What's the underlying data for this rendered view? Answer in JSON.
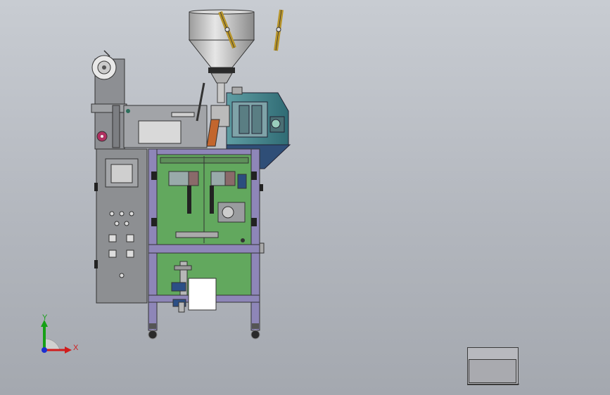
{
  "viewport": {
    "name": "cad-3d-model-viewport",
    "background_top": "#c8ccd2",
    "background_bottom": "#a4a8af"
  },
  "triad": {
    "x_label": "X",
    "y_label": "Y",
    "x_color": "#d11c1c",
    "y_color": "#16a016",
    "z_color": "#1c2fd1"
  },
  "model": {
    "frame_color": "#8e86b8",
    "panel_color": "#8e9093",
    "guard_color": "#62a85e",
    "machine_body_color": "#3f7f86",
    "hopper_color": "#c7c7c7",
    "accent_color": "#c08a2a"
  }
}
